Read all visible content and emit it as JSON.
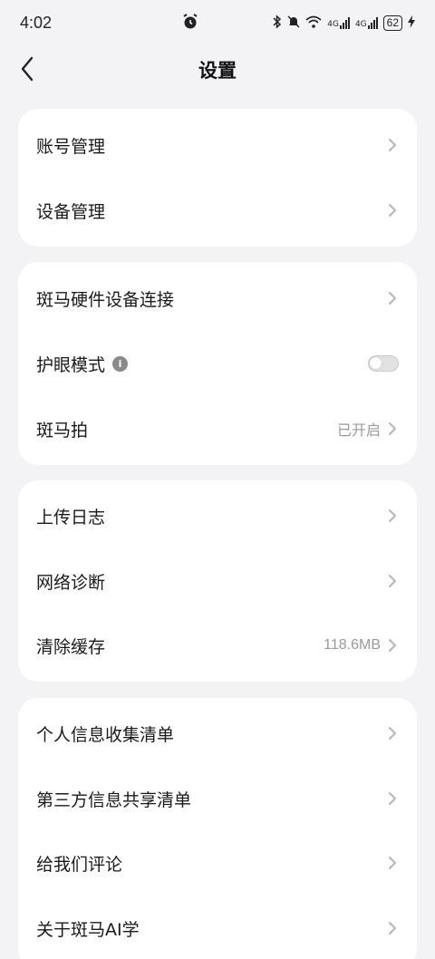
{
  "status_bar": {
    "time": "4:02",
    "network_4g_a": "4G",
    "network_4g_b": "4G",
    "battery": "62"
  },
  "nav": {
    "title": "设置"
  },
  "groups": [
    {
      "items": [
        {
          "label": "账号管理"
        },
        {
          "label": "设备管理"
        }
      ]
    },
    {
      "items": [
        {
          "label": "斑马硬件设备连接"
        },
        {
          "label": "护眼模式",
          "toggle_on": false
        },
        {
          "label": "斑马拍",
          "value": "已开启"
        }
      ]
    },
    {
      "items": [
        {
          "label": "上传日志"
        },
        {
          "label": "网络诊断"
        },
        {
          "label": "清除缓存",
          "value": "118.6MB"
        }
      ]
    },
    {
      "items": [
        {
          "label": "个人信息收集清单"
        },
        {
          "label": "第三方信息共享清单"
        },
        {
          "label": "给我们评论"
        },
        {
          "label": "关于斑马AI学"
        }
      ]
    }
  ],
  "colors": {
    "background": "#f3f3f5",
    "card": "#ffffff",
    "secondary_text": "#9a9a9a",
    "chevron": "#b5b5b8"
  }
}
